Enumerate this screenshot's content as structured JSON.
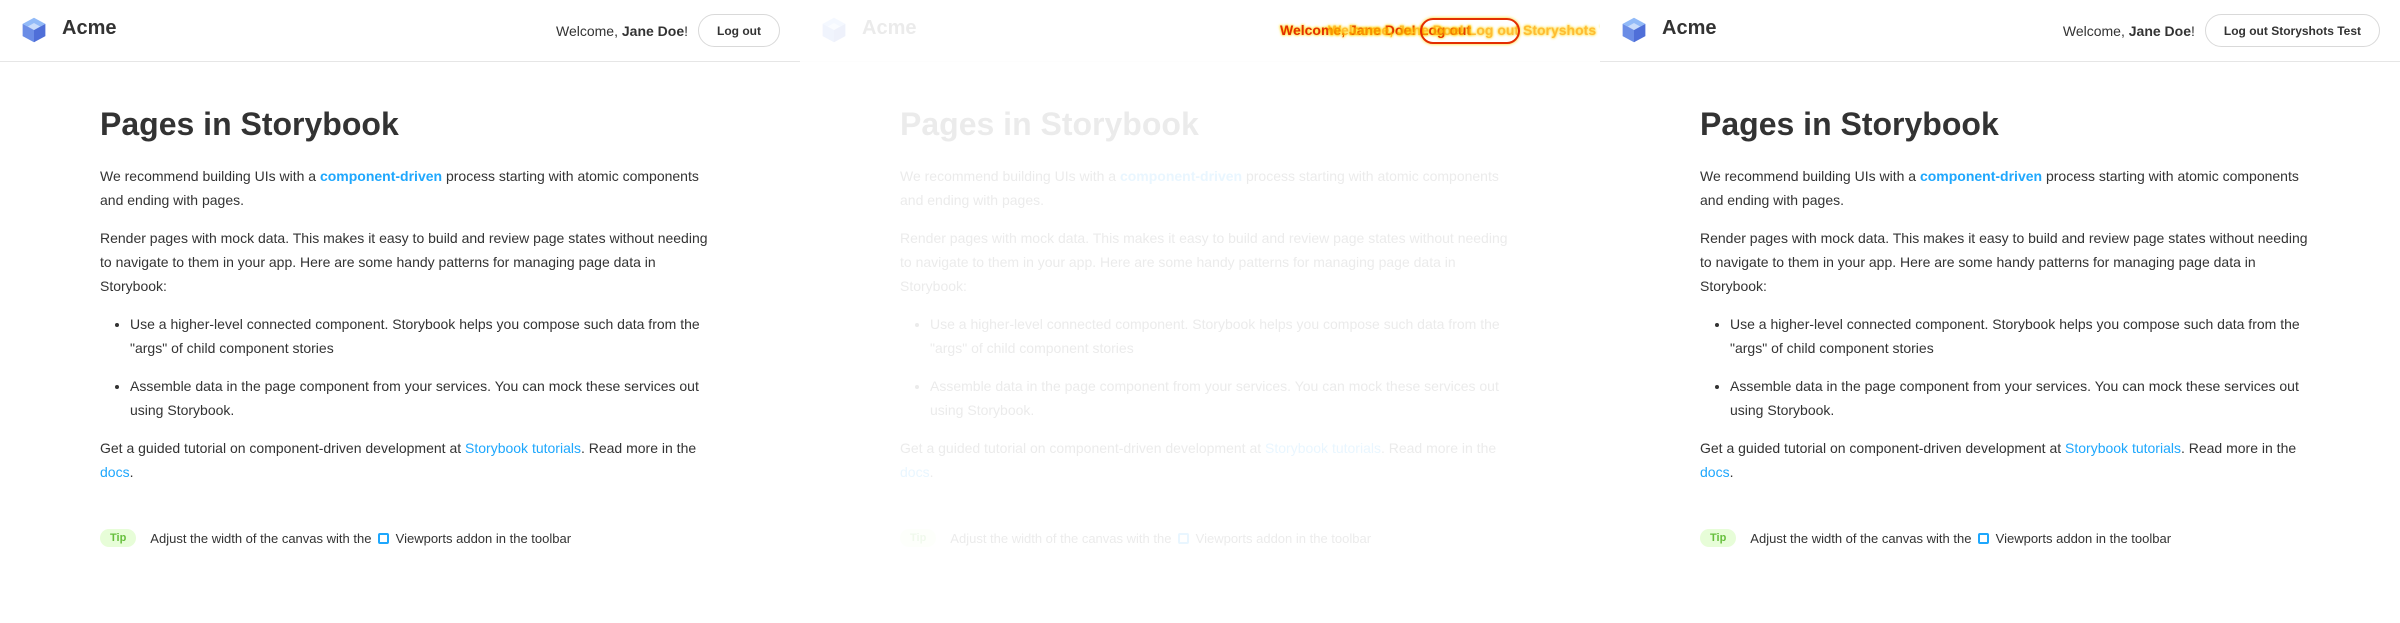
{
  "panels": {
    "before": {
      "brand": "Acme",
      "welcome_prefix": "Welcome, ",
      "user_name": "Jane Doe",
      "welcome_suffix": "!",
      "logout_label": "Log out"
    },
    "diff": {
      "brand": "Acme",
      "diff_text_a": "Welcome, Jane Doe! Log out",
      "diff_text_b": "Welcome, Jane Doe! Log out Storyshots Test"
    },
    "after": {
      "brand": "Acme",
      "welcome_prefix": "Welcome, ",
      "user_name": "Jane Doe",
      "welcome_suffix": "!",
      "logout_label": "Log out Storyshots Test"
    }
  },
  "content": {
    "title": "Pages in Storybook",
    "p1_pre": "We recommend building UIs with a ",
    "p1_link": "component-driven",
    "p1_post": " process starting with atomic components and ending with pages.",
    "p2": "Render pages with mock data. This makes it easy to build and review page states without needing to navigate to them in your app. Here are some handy patterns for managing page data in Storybook:",
    "bullets": [
      "Use a higher-level connected component. Storybook helps you compose such data from the \"args\" of child component stories",
      "Assemble data in the page component from your services. You can mock these services out using Storybook."
    ],
    "p3_pre": "Get a guided tutorial on component-driven development at ",
    "p3_link": "Storybook tutorials",
    "p3_mid": ". Read more in the ",
    "p3_link2": "docs",
    "p3_post": ".",
    "tip_badge": "Tip",
    "tip_pre": "Adjust the width of the canvas with the ",
    "tip_post": " Viewports addon in the toolbar"
  },
  "colors": {
    "link": "#1ea7fd",
    "tip_bg": "#e7fdd8",
    "tip_text": "#66bf3c",
    "diff_red": "#e32e00",
    "diff_yellow": "#ffd400"
  },
  "icons": {
    "logo": "acme-cube-logo-icon",
    "viewport": "viewport-icon"
  }
}
